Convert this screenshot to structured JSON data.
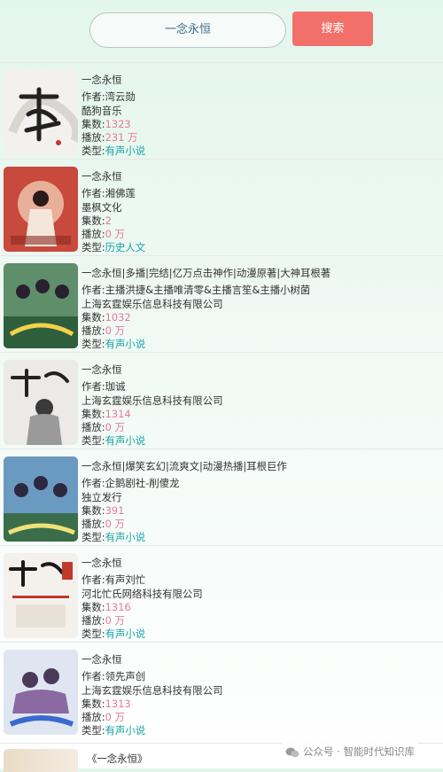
{
  "search": {
    "query": "一念永恒",
    "button_label": "搜索"
  },
  "items": [
    {
      "title": "一念永恒",
      "author_label": "作者:",
      "author": "湾云勋",
      "publisher": "酷狗音乐",
      "episodes_label": "集数:",
      "episodes": "1323",
      "plays_label": "播放:",
      "plays": "231 万",
      "type_label": "类型:",
      "type": "有声小说"
    },
    {
      "title": "一念永恒",
      "author_label": "作者:",
      "author": "湘佛莲",
      "publisher": "墨枫文化",
      "episodes_label": "集数:",
      "episodes": "2",
      "plays_label": "播放:",
      "plays": "0 万",
      "type_label": "类型:",
      "type": "历史人文"
    },
    {
      "title": "一念永恒|多播|完结|亿万点击神作|动漫原著|大神耳根著",
      "author_label": "作者:",
      "author": "主播洪捷&主播唯清零&主播言笙&主播小树菌",
      "publisher": "上海玄霆娱乐信息科技有限公司",
      "episodes_label": "集数:",
      "episodes": "1032",
      "plays_label": "播放:",
      "plays": "0 万",
      "type_label": "类型:",
      "type": "有声小说"
    },
    {
      "title": "一念永恒",
      "author_label": "作者:",
      "author": "珈诚",
      "publisher": "上海玄霆娱乐信息科技有限公司",
      "episodes_label": "集数:",
      "episodes": "1314",
      "plays_label": "播放:",
      "plays": "0 万",
      "type_label": "类型:",
      "type": "有声小说"
    },
    {
      "title": "一念永恒|爆笑玄幻|流爽文|动漫热播|耳根巨作",
      "author_label": "作者:",
      "author": "企鹅剧社-削傻龙",
      "publisher": "独立发行",
      "episodes_label": "集数:",
      "episodes": "391",
      "plays_label": "播放:",
      "plays": "0 万",
      "type_label": "类型:",
      "type": "有声小说"
    },
    {
      "title": "一念永恒",
      "author_label": "作者:",
      "author": "有声刘忙",
      "publisher": "河北忙氏网络科技有限公司",
      "episodes_label": "集数:",
      "episodes": "1316",
      "plays_label": "播放:",
      "plays": "0 万",
      "type_label": "类型:",
      "type": "有声小说"
    },
    {
      "title": "一念永恒",
      "author_label": "作者:",
      "author": "领先声创",
      "publisher": "上海玄霆娱乐信息科技有限公司",
      "episodes_label": "集数:",
      "episodes": "1313",
      "plays_label": "播放:",
      "plays": "0 万",
      "type_label": "类型:",
      "type": "有声小说"
    }
  ],
  "last_item": {
    "title": "《一念永恒》"
  },
  "watermark": {
    "text": "公众号 · 智能时代知识库"
  },
  "colors": {
    "accent": "#f2706a",
    "pink": "#e8789a",
    "teal": "#19a3a3"
  }
}
